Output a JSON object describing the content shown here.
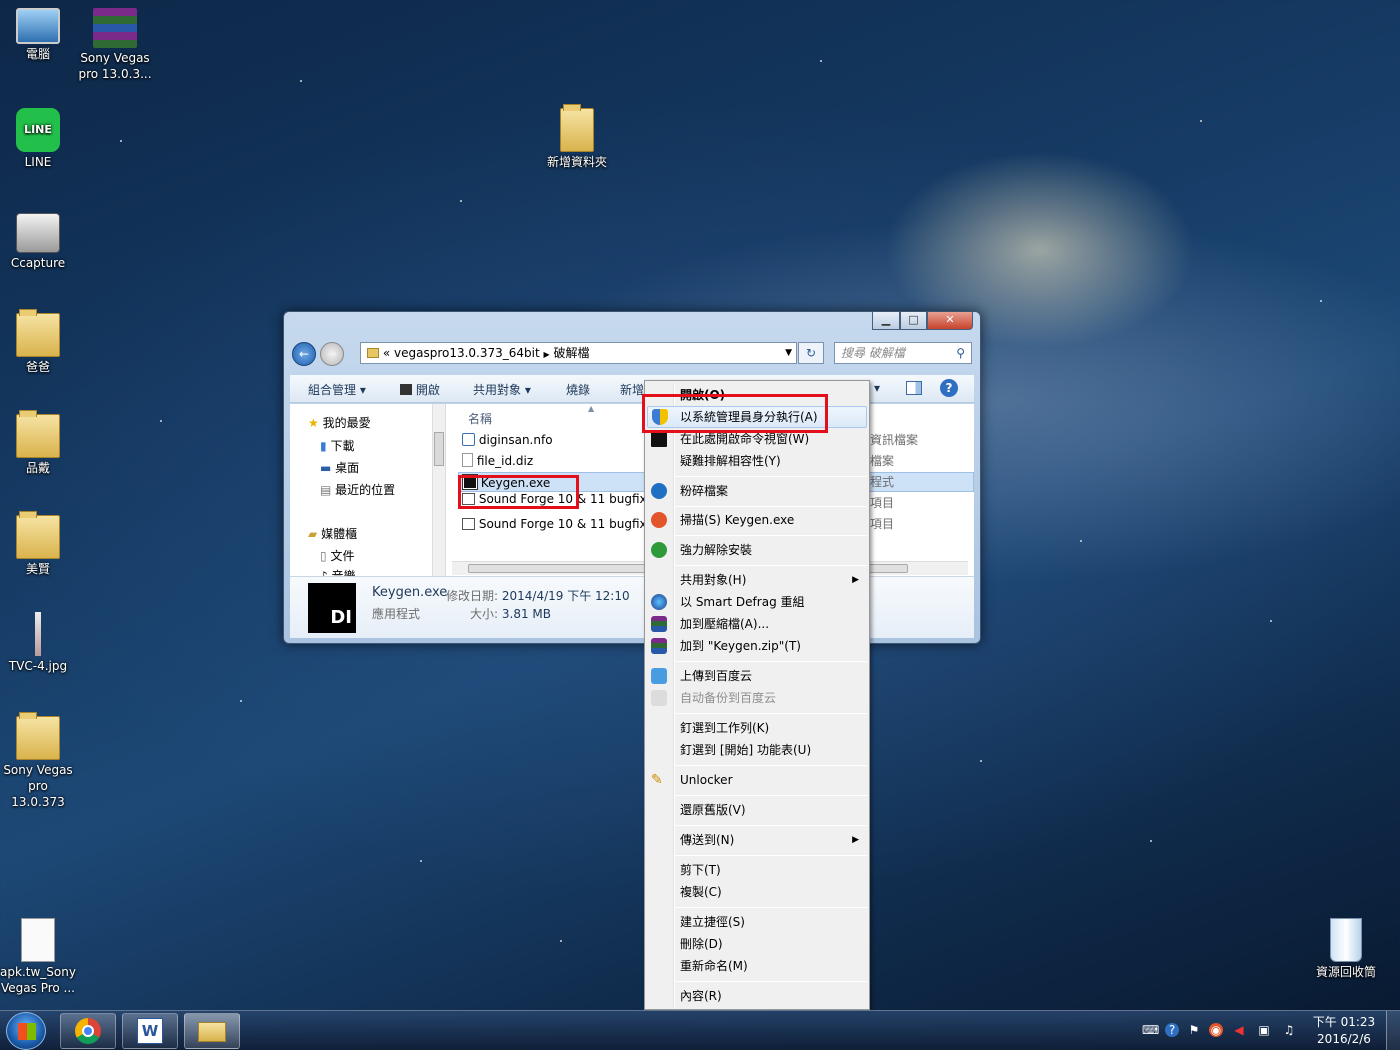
{
  "desktop": {
    "icons": [
      {
        "label": "電腦"
      },
      {
        "label": "Sony Vegas pro 13.0.3..."
      },
      {
        "label": "LINE"
      },
      {
        "label": "Ccapture"
      },
      {
        "label": "爸爸"
      },
      {
        "label": "品戴"
      },
      {
        "label": "美賢"
      },
      {
        "label": "TVC-4.jpg"
      },
      {
        "label": "Sony Vegas pro 13.0.373"
      },
      {
        "label": "apk.tw_Sony Vegas Pro ..."
      },
      {
        "label": "新增資料夾"
      },
      {
        "label": "資源回收筒"
      }
    ]
  },
  "window": {
    "address": {
      "prefix": "«",
      "seg1": "vegaspro13.0.373_64bit",
      "seg2": "破解檔"
    },
    "search_placeholder": "搜尋 破解檔",
    "toolbar": {
      "organize": "組合管理",
      "open": "開啟",
      "share": "共用對象",
      "burn": "燒錄",
      "new": "新增"
    },
    "nav": {
      "favorites": "我的最愛",
      "downloads": "下載",
      "desktop": "桌面",
      "recent": "最近的位置",
      "libraries": "媒體櫃",
      "documents": "文件",
      "music": "音樂"
    },
    "column_name": "名稱",
    "files": [
      {
        "name": "diginsan.nfo",
        "type": "資訊檔案"
      },
      {
        "name": "file_id.diz",
        "type": "檔案"
      },
      {
        "name": "Keygen.exe",
        "type": "程式"
      },
      {
        "name": "Sound Forge 10 & 11 bugfix",
        "type": "項目"
      },
      {
        "name": "Sound Forge 10 & 11 bugfix",
        "type": "項目"
      }
    ],
    "details": {
      "name": "Keygen.exe",
      "kind": "應用程式",
      "modified_label": "修改日期:",
      "modified": "2014/4/19 下午 12:10",
      "size_label": "大小:",
      "size": "3.81 MB",
      "thumb_text": "DI"
    }
  },
  "context_menu": {
    "open": "開啟(O)",
    "run_as_admin": "以系統管理員身分執行(A)",
    "open_cmd": "在此處開啟命令視窗(W)",
    "troubleshoot": "疑難排解相容性(Y)",
    "shred": "粉碎檔案",
    "scan": "掃描(S) Keygen.exe",
    "force_uninstall": "強力解除安裝",
    "share": "共用對象(H)",
    "smart_defrag": "以 Smart Defrag 重組",
    "add_archive": "加到壓縮檔(A)...",
    "add_zip": "加到 \"Keygen.zip\"(T)",
    "upload_baidu": "上傳到百度云",
    "auto_backup": "自动备份到百度云",
    "pin_taskbar": "釘選到工作列(K)",
    "pin_start": "釘選到 [開始] 功能表(U)",
    "unlocker": "Unlocker",
    "restore": "還原舊版(V)",
    "send_to": "傳送到(N)",
    "cut": "剪下(T)",
    "copy": "複製(C)",
    "shortcut": "建立捷徑(S)",
    "delete": "刪除(D)",
    "rename": "重新命名(M)",
    "properties": "內容(R)"
  },
  "taskbar": {
    "time": "下午 01:23",
    "date": "2016/2/6"
  }
}
